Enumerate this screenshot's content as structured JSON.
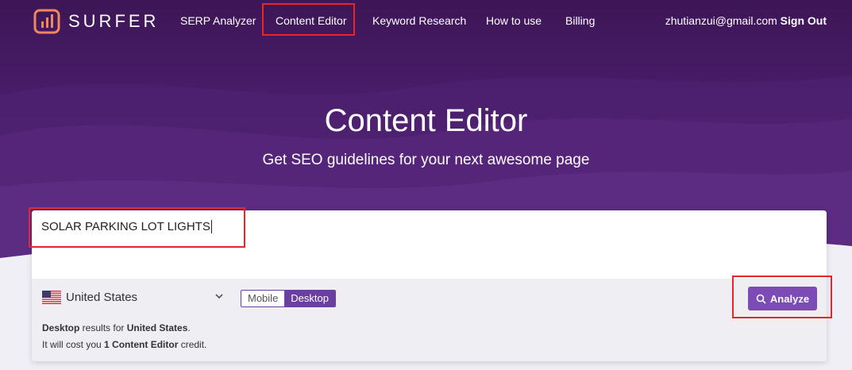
{
  "brand": {
    "name": "SURFER",
    "accent": "#7d4bb5",
    "logo_color": "#f2875b"
  },
  "nav": {
    "items": [
      "SERP Analyzer",
      "Content Editor",
      "Keyword Research",
      "How to use",
      "Billing"
    ],
    "active": "Content Editor"
  },
  "account": {
    "email": "zhutianzui@gmail.com",
    "sign_out": "Sign Out"
  },
  "hero": {
    "title": "Content Editor",
    "subtitle": "Get SEO guidelines for your next awesome page"
  },
  "search": {
    "value": "SOLAR PARKING LOT LIGHTS"
  },
  "country": {
    "flag_icon": "us-flag-icon",
    "selected": "United States"
  },
  "device": {
    "options": [
      "Mobile",
      "Desktop"
    ],
    "selected": "Desktop"
  },
  "info": {
    "line1_device": "Desktop",
    "line1_mid": " results for ",
    "line1_country": "United States",
    "line1_end": ".",
    "line2_start": "It will cost you ",
    "line2_bold": "1 Content Editor",
    "line2_end": " credit."
  },
  "analyze": {
    "label": "Analyze",
    "icon": "search-icon"
  },
  "annotation_color": "#e8262a"
}
